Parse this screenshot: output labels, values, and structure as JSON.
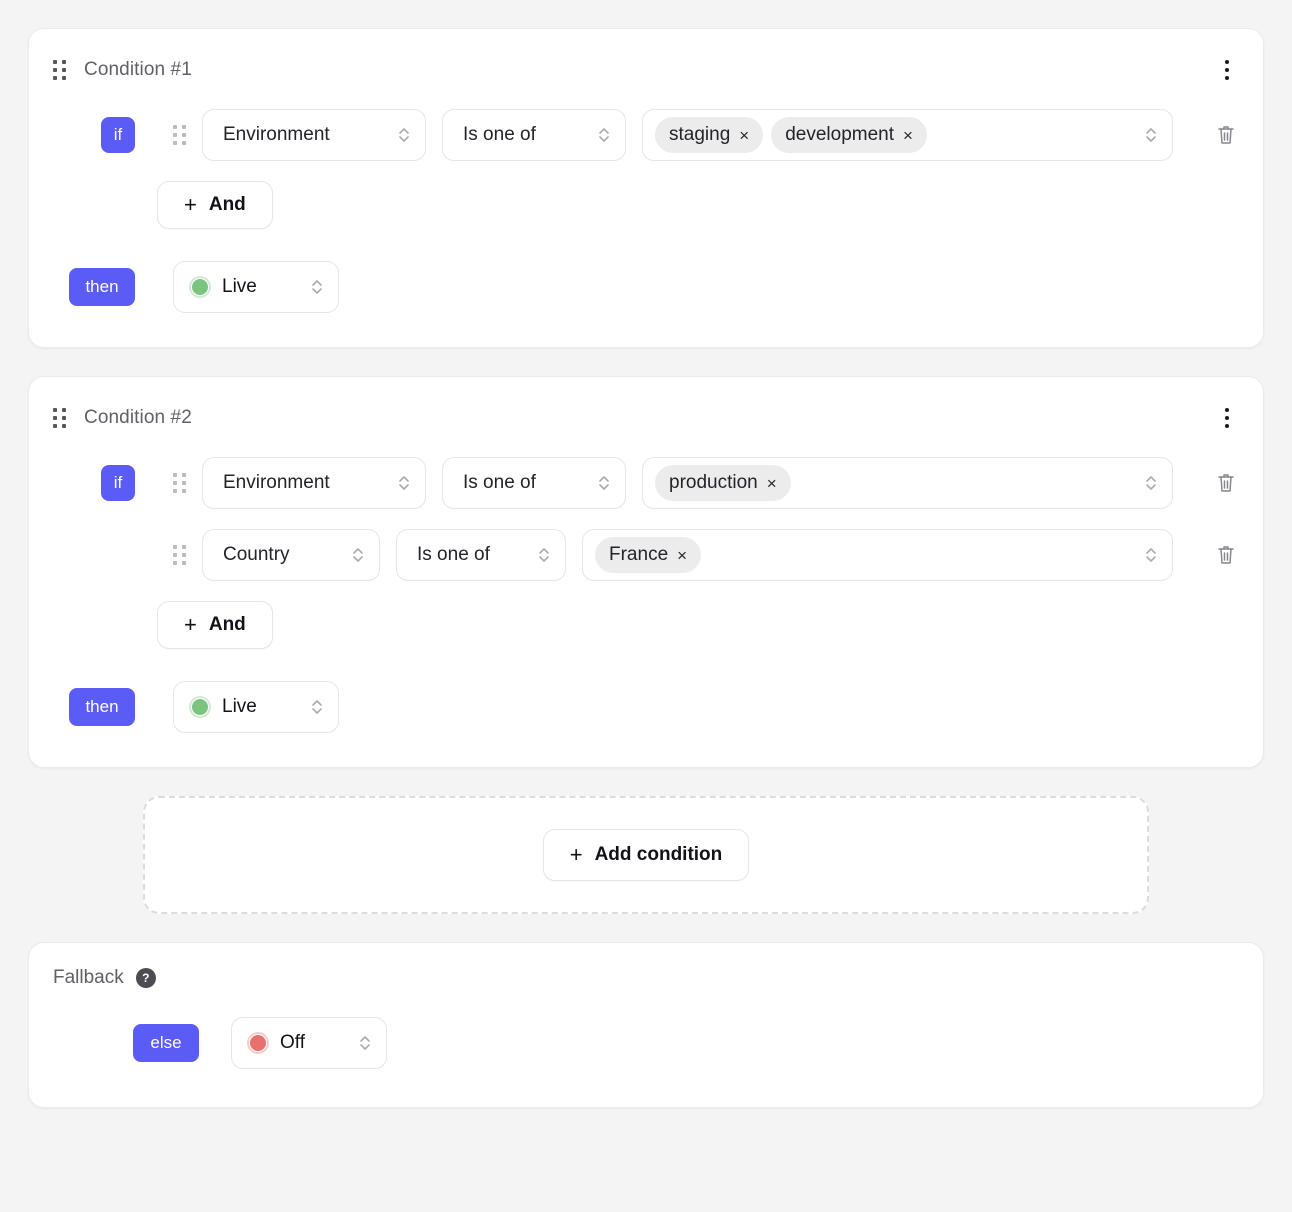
{
  "theme": {
    "accent": "#5b5bf5",
    "page_bg": "#f4f4f5",
    "card_bg": "#ffffff",
    "border": "#e6e6e9",
    "tag_bg": "#ececed",
    "live_color": "#7ac47f",
    "off_color": "#e8706f",
    "title_color": "#5f6167"
  },
  "conditions": [
    {
      "title": "Condition #1",
      "drag_handle_icon": "drag-handle-icon",
      "menu_icon": "kebab-menu-icon",
      "if_label": "if",
      "then_label": "then",
      "rules": [
        {
          "field": "Environment",
          "operator": "Is one of",
          "values": [
            "staging",
            "development"
          ],
          "remove_icon": "trash-icon"
        }
      ],
      "and_label": "And",
      "and_plus": "+",
      "then": {
        "status": "Live",
        "color": "#7ac47f"
      }
    },
    {
      "title": "Condition #2",
      "drag_handle_icon": "drag-handle-icon",
      "menu_icon": "kebab-menu-icon",
      "if_label": "if",
      "then_label": "then",
      "rules": [
        {
          "field": "Environment",
          "operator": "Is one of",
          "values": [
            "production"
          ],
          "remove_icon": "trash-icon"
        },
        {
          "field": "Country",
          "operator": "Is one of",
          "values": [
            "France"
          ],
          "remove_icon": "trash-icon"
        }
      ],
      "and_label": "And",
      "and_plus": "+",
      "then": {
        "status": "Live",
        "color": "#7ac47f"
      }
    }
  ],
  "add_condition": {
    "label": "Add condition",
    "plus": "+"
  },
  "fallback": {
    "title": "Fallback",
    "help_glyph": "?",
    "else_label": "else",
    "status": "Off",
    "status_color": "#e8706f"
  },
  "icons": {
    "tag_close": "×",
    "chevron_updown": "chevron-up-down-icon"
  }
}
